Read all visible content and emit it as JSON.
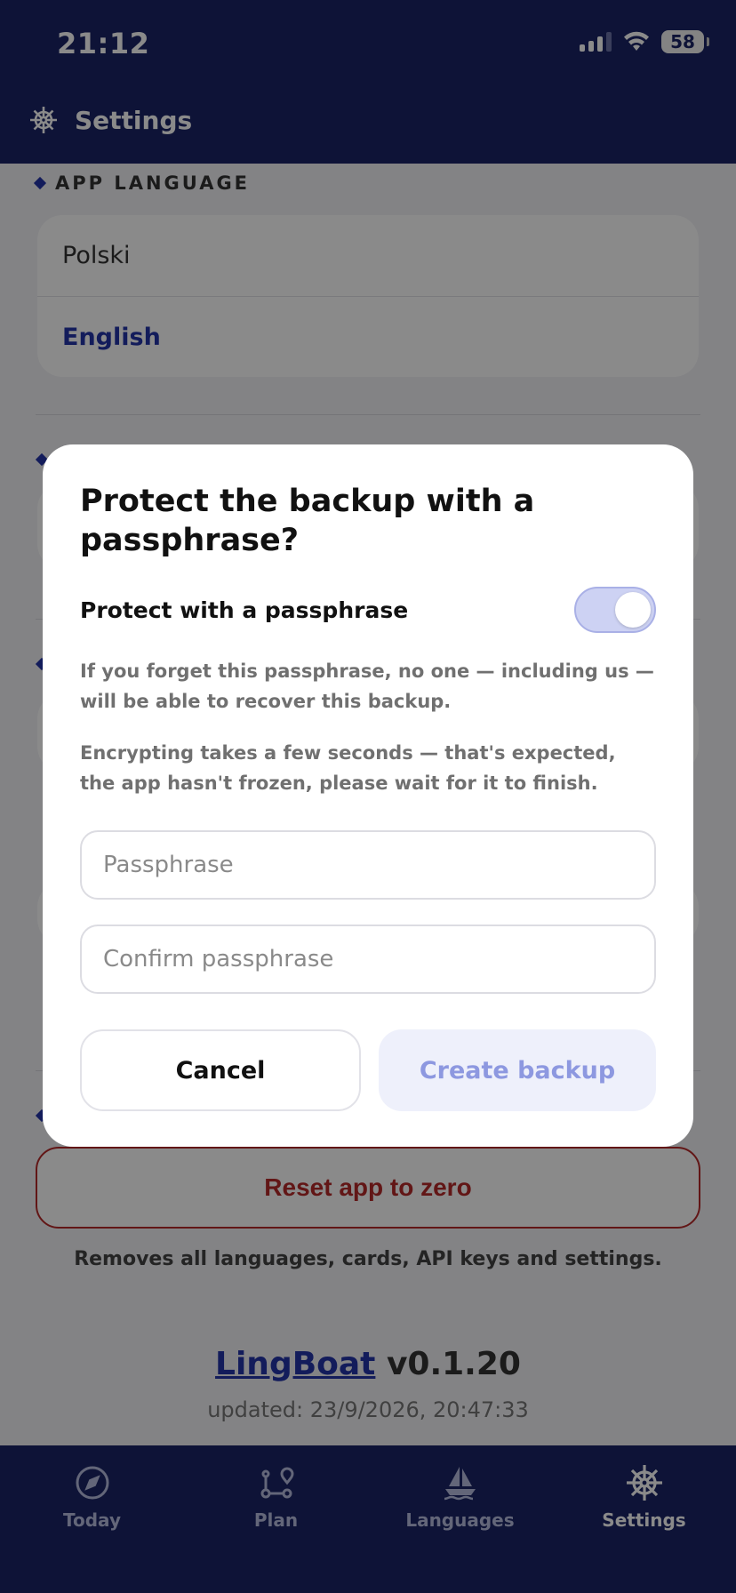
{
  "status_bar": {
    "time": "21:12",
    "battery": "58"
  },
  "header": {
    "title": "Settings",
    "icon": "ship-wheel-icon"
  },
  "settings": {
    "app_language_label": "APP LANGUAGE",
    "languages": [
      "Polski",
      "English"
    ],
    "selected_language": "English",
    "reset_button": "Reset app to zero",
    "reset_note": "Removes all languages, cards, API keys and settings.",
    "app_name": "LingBoat",
    "version": "v0.1.20",
    "updated": "updated: 23/9/2026, 20:47:33"
  },
  "tabs": [
    {
      "label": "Today",
      "icon": "compass-icon",
      "active": false
    },
    {
      "label": "Plan",
      "icon": "route-icon",
      "active": false
    },
    {
      "label": "Languages",
      "icon": "sailboat-icon",
      "active": false
    },
    {
      "label": "Settings",
      "icon": "ship-wheel-icon",
      "active": true
    }
  ],
  "modal": {
    "title": "Protect the backup with a passphrase?",
    "toggle_label": "Protect with a passphrase",
    "toggle_on": true,
    "warning": "If you forget this passphrase, no one — including us — will be able to recover this backup.",
    "info": "Encrypting takes a few seconds — that's expected, the app hasn't frozen, please wait for it to finish.",
    "passphrase_placeholder": "Passphrase",
    "confirm_placeholder": "Confirm passphrase",
    "cancel_label": "Cancel",
    "create_label": "Create backup"
  },
  "colors": {
    "brand": "#1a2466",
    "accent": "#2434a8",
    "danger": "#b52a2a"
  }
}
